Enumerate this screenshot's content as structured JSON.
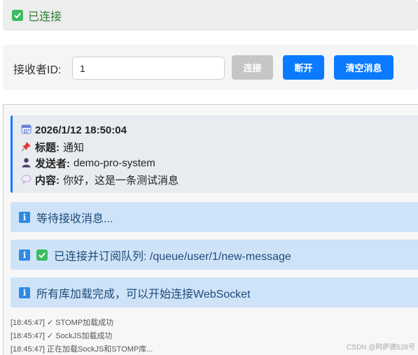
{
  "status": {
    "icon": "check-mark-icon",
    "text": "已连接",
    "color": "#3dbb62"
  },
  "controls": {
    "receiver_label": "接收者ID:",
    "receiver_value": "1",
    "connect_label": "连接",
    "disconnect_label": "断开",
    "clear_label": "清空消息"
  },
  "message_card": {
    "time_icon": "calendar-icon",
    "time": "2026/1/12 18:50:04",
    "title_icon": "pushpin-icon",
    "title_label": "标题:",
    "title_value": "通知",
    "sender_icon": "person-icon",
    "sender_label": "发送者:",
    "sender_value": "demo-pro-system",
    "content_icon": "speech-bubble-icon",
    "content_label": "内容:",
    "content_value": "你好，这是一条测试消息"
  },
  "info_messages": [
    {
      "icon": "info-icon",
      "text": "等待接收消息..."
    },
    {
      "icon": "info-icon",
      "text": "已连接并订阅队列: /queue/user/1/new-message"
    },
    {
      "icon": "info-icon",
      "text": "所有库加载完成，可以开始连接WebSocket"
    }
  ],
  "logs": [
    "[18:45:47] ✓ STOMP加载成功",
    "[18:45:47] ✓ SockJS加载成功",
    "[18:45:47] 正在加载SockJS和STOMP库..."
  ],
  "watermark": "CSDN @阿萨德528号",
  "colors": {
    "primary": "#0a7bff",
    "disabled": "#c6c6c6",
    "info_bg": "#cfe3f8",
    "success": "#3dbb62"
  }
}
